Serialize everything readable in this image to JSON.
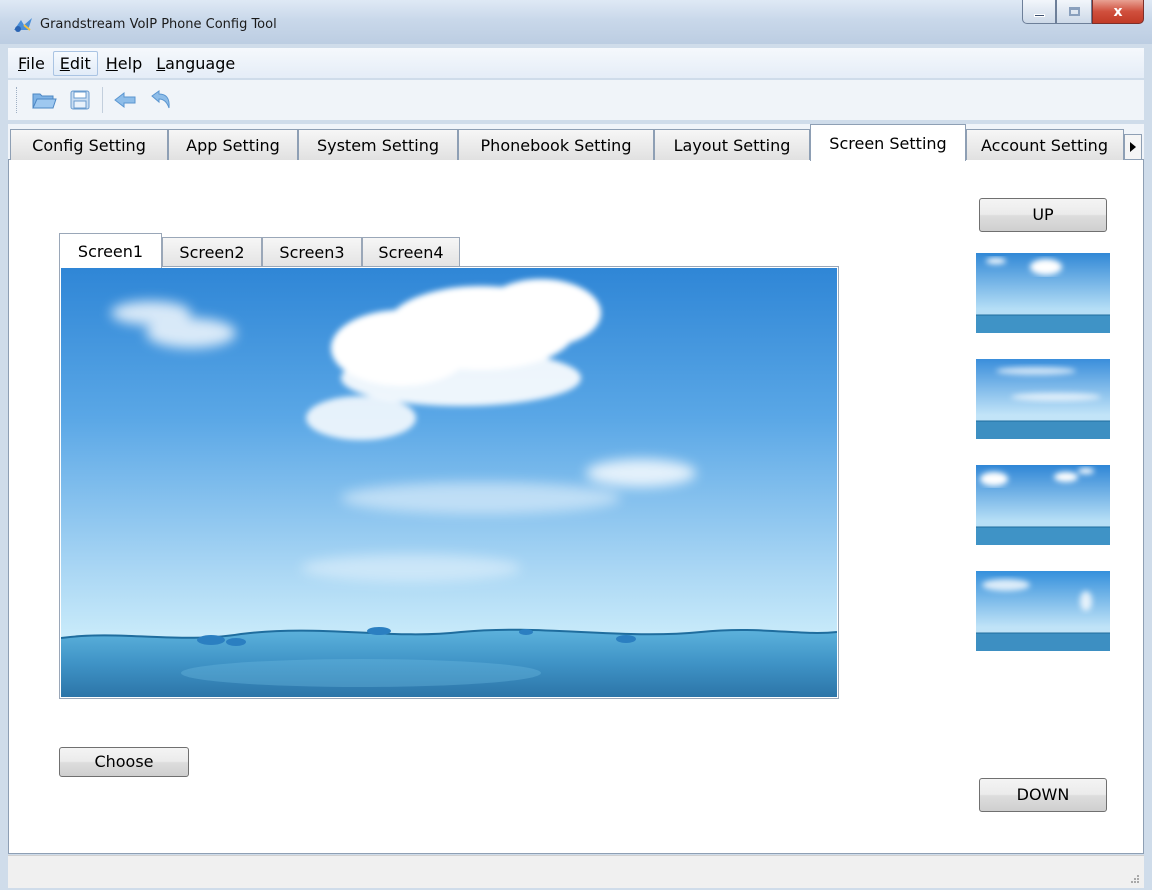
{
  "window": {
    "title": "Grandstream VoIP Phone Config Tool",
    "close_glyph": "x"
  },
  "menu": [
    {
      "label": "File",
      "u": "F",
      "rest": "ile"
    },
    {
      "label": "Edit",
      "u": "E",
      "rest": "dit"
    },
    {
      "label": "Help",
      "u": "H",
      "rest": "elp"
    },
    {
      "label": "Language",
      "u": "L",
      "rest": "anguage"
    }
  ],
  "toolbar": {
    "icons": [
      "open-folder-icon",
      "save-icon",
      "back-arrow-icon",
      "undo-icon"
    ]
  },
  "main_tabs": [
    {
      "label": "Config Setting"
    },
    {
      "label": "App Setting"
    },
    {
      "label": "System Setting"
    },
    {
      "label": "Phonebook Setting"
    },
    {
      "label": "Layout Setting"
    },
    {
      "label": "Screen Setting",
      "active": true
    },
    {
      "label": "Account Setting"
    }
  ],
  "screen_tabs": [
    {
      "label": "Screen1",
      "active": true
    },
    {
      "label": "Screen2"
    },
    {
      "label": "Screen3"
    },
    {
      "label": "Screen4"
    }
  ],
  "buttons": {
    "choose": "Choose",
    "up": "UP",
    "down": "DOWN"
  },
  "colors": {
    "accent_sky": "#3a8fdc",
    "sea": "#2d7fb3",
    "tab_border": "#8e9fb4",
    "title_bar": "#c9d8ea"
  }
}
